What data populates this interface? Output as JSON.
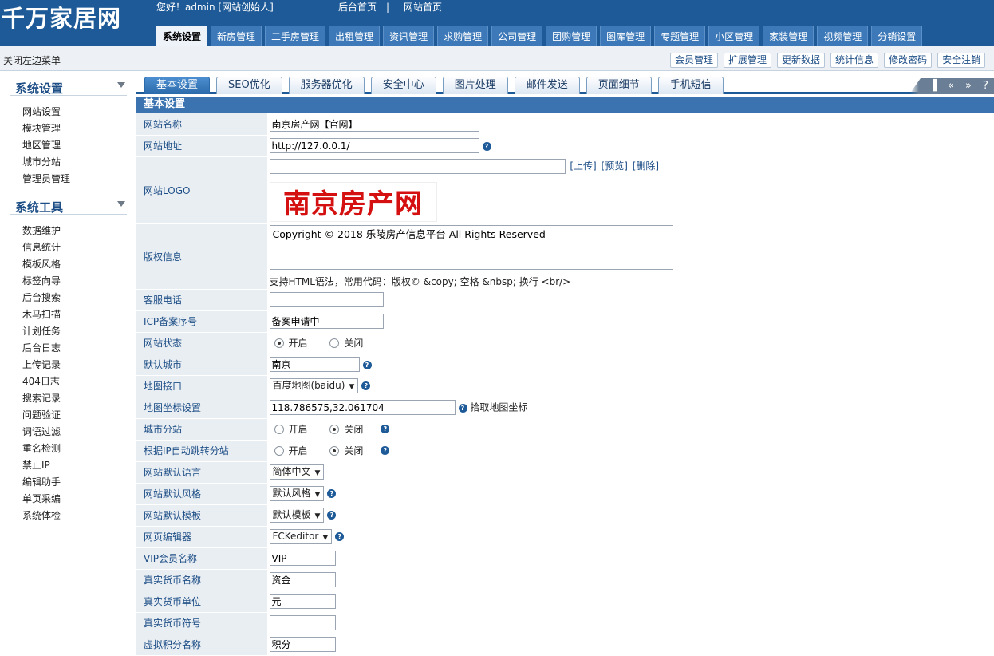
{
  "app": {
    "logo_text": "千万家居网",
    "greeting": "您好！admin [网站创始人]",
    "link_admin_home": "后台首页",
    "separator": "|",
    "link_site_home": "网站首页"
  },
  "main_tabs": [
    "系统设置",
    "新房管理",
    "二手房管理",
    "出租管理",
    "资讯管理",
    "求购管理",
    "公司管理",
    "团购管理",
    "图库管理",
    "专题管理",
    "小区管理",
    "家装管理",
    "视频管理",
    "分销设置"
  ],
  "active_main_tab": "系统设置",
  "subbar": {
    "close_menu": "关闭左边菜单",
    "buttons": [
      "会员管理",
      "扩展管理",
      "更新数据",
      "统计信息",
      "修改密码",
      "安全注销"
    ]
  },
  "sidebar": {
    "groups": [
      {
        "title": "系统设置",
        "items": [
          "网站设置",
          "模块管理",
          "地区管理",
          "城市分站",
          "管理员管理"
        ]
      },
      {
        "title": "系统工具",
        "items": [
          "数据维护",
          "信息统计",
          "模板风格",
          "标签向导",
          "后台搜索",
          "木马扫描",
          "计划任务",
          "后台日志",
          "上传记录",
          "404日志",
          "搜索记录",
          "问题验证",
          "词语过滤",
          "重名检测",
          "禁止IP",
          "编辑助手",
          "单页采编",
          "系统体检"
        ]
      }
    ]
  },
  "sub_tabs": [
    "基本设置",
    "SEO优化",
    "服务器优化",
    "安全中心",
    "图片处理",
    "邮件发送",
    "页面细节",
    "手机短信"
  ],
  "active_sub_tab": "基本设置",
  "nav_controls": [
    "▌",
    "«",
    "»",
    "?"
  ],
  "section_title": "基本设置",
  "form": {
    "site_name": {
      "label": "网站名称",
      "value": "南京房产网【官网】"
    },
    "site_url": {
      "label": "网站地址",
      "value": "http://127.0.0.1/"
    },
    "site_logo": {
      "label": "网站LOGO",
      "value": "",
      "upload": "[上传]",
      "preview": "[预览]",
      "delete": "[删除]",
      "logo_text": "南京房产网"
    },
    "copyright": {
      "label": "版权信息",
      "value": "Copyright © 2018 乐陵房产信息平台 All Rights Reserved",
      "hint": "支持HTML语法，常用代码：版权© &copy; 空格 &nbsp; 换行 <br/>"
    },
    "service_phone": {
      "label": "客服电话",
      "value": ""
    },
    "icp": {
      "label": "ICP备案序号",
      "value": "备案申请中"
    },
    "site_status": {
      "label": "网站状态",
      "on": "开启",
      "off": "关闭",
      "selected": "开启"
    },
    "default_city": {
      "label": "默认城市",
      "value": "南京"
    },
    "map_api": {
      "label": "地图接口",
      "value": "百度地图(baidu)"
    },
    "map_coord": {
      "label": "地图坐标设置",
      "value": "118.786575,32.061704",
      "pick": "拾取地图坐标"
    },
    "city_station": {
      "label": "城市分站",
      "on": "开启",
      "off": "关闭",
      "selected": "关闭"
    },
    "ip_redirect": {
      "label": "根据IP自动跳转分站",
      "on": "开启",
      "off": "关闭",
      "selected": "关闭"
    },
    "default_lang": {
      "label": "网站默认语言",
      "value": "简体中文"
    },
    "default_style": {
      "label": "网站默认风格",
      "value": "默认风格"
    },
    "default_template": {
      "label": "网站默认模板",
      "value": "默认模板"
    },
    "editor": {
      "label": "网页编辑器",
      "value": "FCKeditor"
    },
    "vip_name": {
      "label": "VIP会员名称",
      "value": "VIP"
    },
    "money_name": {
      "label": "真实货币名称",
      "value": "资金"
    },
    "money_unit": {
      "label": "真实货币单位",
      "value": "元"
    },
    "money_symbol": {
      "label": "真实货币符号",
      "value": ""
    },
    "points_name": {
      "label": "虚拟积分名称",
      "value": "积分"
    }
  },
  "colors": {
    "header": "#1d5a97",
    "accent": "#3a73b0",
    "label_bg": "#e9eef3",
    "logo_red": "#d41010"
  }
}
